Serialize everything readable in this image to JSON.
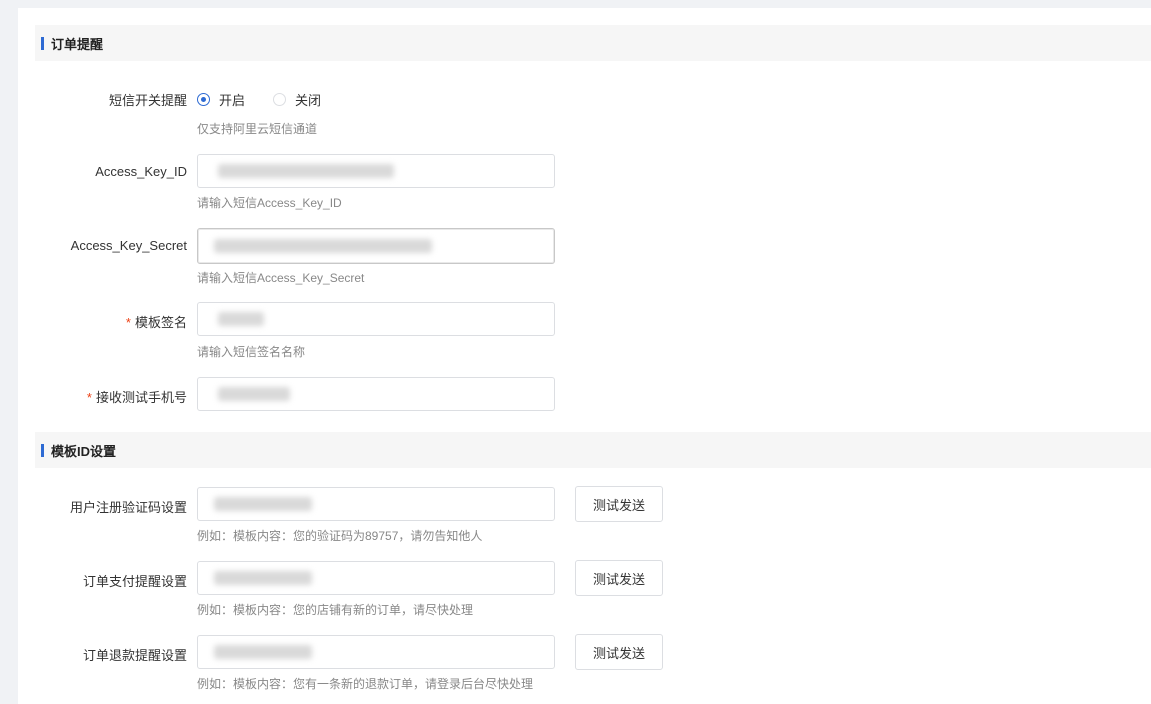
{
  "section_order_reminder": {
    "title": "订单提醒",
    "sms_switch": {
      "label": "短信开关提醒",
      "options": [
        "开启",
        "关闭"
      ],
      "selected": "开启",
      "hint": "仅支持阿里云短信通道"
    },
    "access_key_id": {
      "label": "Access_Key_ID",
      "hint": "请输入短信Access_Key_ID"
    },
    "access_key_secret": {
      "label": "Access_Key_Secret",
      "hint": "请输入短信Access_Key_Secret"
    },
    "template_sign": {
      "required_mark": "*",
      "label": "模板签名",
      "hint": "请输入短信签名名称"
    },
    "test_phone": {
      "required_mark": "*",
      "label": "接收测试手机号"
    }
  },
  "section_template_id": {
    "title": "模板ID设置",
    "rows": [
      {
        "label": "用户注册验证码设置",
        "button": "测试发送",
        "hint": "例如：模板内容：您的验证码为89757，请勿告知他人"
      },
      {
        "label": "订单支付提醒设置",
        "button": "测试发送",
        "hint": "例如：模板内容：您的店铺有新的订单，请尽快处理"
      },
      {
        "label": "订单退款提醒设置",
        "button": "测试发送",
        "hint": "例如：模板内容：您有一条新的退款订单，请登录后台尽快处理"
      }
    ]
  },
  "colors": {
    "accent": "#2d6ad3",
    "required": "#ed4014",
    "section_bg": "#f6f6f6",
    "hint_text": "#888888"
  }
}
